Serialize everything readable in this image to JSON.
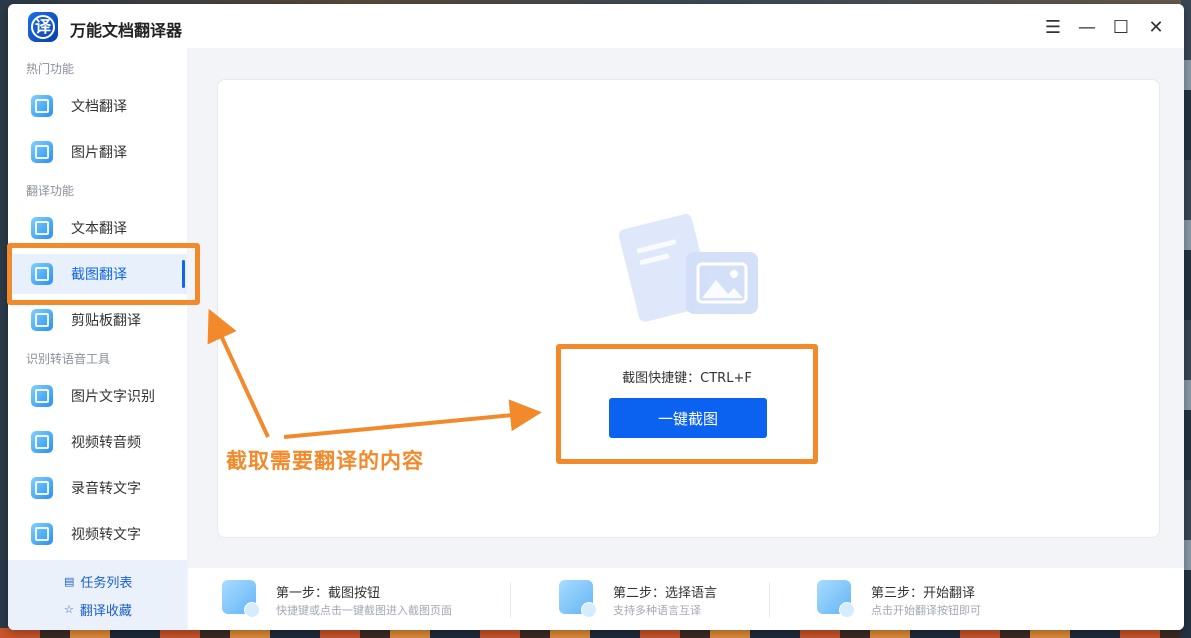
{
  "app": {
    "title": "万能文档翻译器",
    "logo_char": "译"
  },
  "window_controls": {
    "menu": "☰",
    "minimize": "—",
    "maximize": "☐",
    "close": "✕"
  },
  "sidebar": {
    "sections": [
      {
        "label": "热门功能"
      },
      {
        "label": "翻译功能"
      },
      {
        "label": "识别转语音工具"
      }
    ],
    "items": [
      {
        "label": "文档翻译",
        "icon": "document-translate-icon"
      },
      {
        "label": "图片翻译",
        "icon": "image-translate-icon"
      },
      {
        "label": "文本翻译",
        "icon": "text-translate-icon"
      },
      {
        "label": "截图翻译",
        "icon": "screenshot-translate-icon",
        "active": true
      },
      {
        "label": "剪贴板翻译",
        "icon": "clipboard-translate-icon"
      },
      {
        "label": "图片文字识别",
        "icon": "ocr-icon"
      },
      {
        "label": "视频转音频",
        "icon": "video-to-audio-icon"
      },
      {
        "label": "录音转文字",
        "icon": "audio-to-text-icon"
      },
      {
        "label": "视频转文字",
        "icon": "video-to-text-icon"
      }
    ],
    "bottom_links": [
      {
        "label": "任务列表",
        "icon": "list-icon"
      },
      {
        "label": "翻译收藏",
        "icon": "star-icon"
      }
    ]
  },
  "main": {
    "shortcut_text": "截图快捷键：CTRL+F",
    "capture_button": "一键截图"
  },
  "steps": [
    {
      "title": "第一步：截图按钮",
      "desc": "快捷键或点击一键截图进入截图页面"
    },
    {
      "title": "第二步：选择语言",
      "desc": "支持多种语言互译"
    },
    {
      "title": "第三步：开始翻译",
      "desc": "点击开始翻译按钮即可"
    }
  ],
  "annotation": {
    "text": "截取需要翻译的内容"
  },
  "colors": {
    "accent": "#0b62f0",
    "highlight": "#f28a2b",
    "active_bg": "#e8f0fc"
  }
}
